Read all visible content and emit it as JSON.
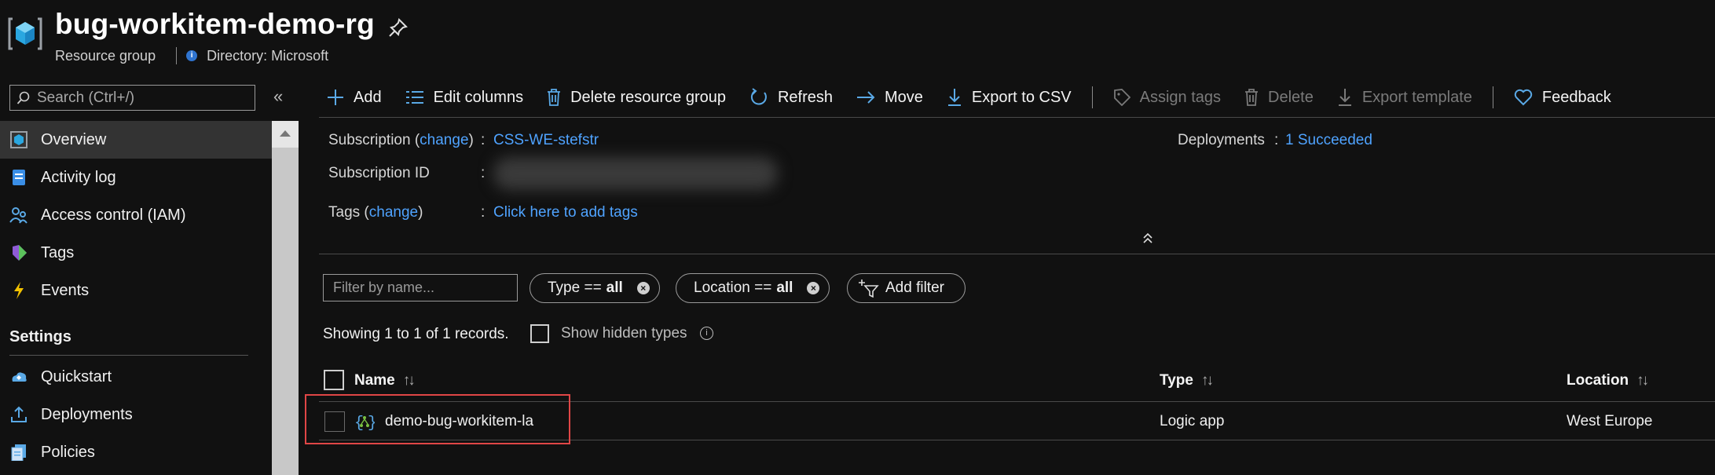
{
  "header": {
    "title": "bug-workitem-demo-rg",
    "resource_type": "Resource group",
    "directory": "Directory: Microsoft",
    "info_glyph": "i"
  },
  "sidebar": {
    "search_placeholder": "Search (Ctrl+/)",
    "collapse_glyph": "«",
    "items": [
      {
        "label": "Overview",
        "icon": "overview-icon",
        "active": true
      },
      {
        "label": "Activity log",
        "icon": "activity-log-icon"
      },
      {
        "label": "Access control (IAM)",
        "icon": "iam-icon"
      },
      {
        "label": "Tags",
        "icon": "tag-icon"
      },
      {
        "label": "Events",
        "icon": "lightning-icon"
      }
    ],
    "settings_header": "Settings",
    "settings_items": [
      {
        "label": "Quickstart",
        "icon": "quickstart-icon"
      },
      {
        "label": "Deployments",
        "icon": "deployments-icon"
      },
      {
        "label": "Policies",
        "icon": "policies-icon"
      }
    ]
  },
  "toolbar": {
    "add": "Add",
    "edit_columns": "Edit columns",
    "delete_rg": "Delete resource group",
    "refresh": "Refresh",
    "move": "Move",
    "export_csv": "Export to CSV",
    "assign_tags": "Assign tags",
    "delete": "Delete",
    "export_template": "Export template",
    "feedback": "Feedback"
  },
  "essentials": {
    "subscription_prefix": "Subscription (",
    "change": "change",
    "subscription_suffix": ")",
    "colon": ":",
    "subscription_value": "CSS-WE-stefstr",
    "subscription_id_label": "Subscription ID",
    "tags_prefix": "Tags (",
    "tags_suffix": ")",
    "tags_value": "Click here to add tags",
    "deployments_label": "Deployments",
    "deployments_value": "1 Succeeded"
  },
  "filters": {
    "name_placeholder": "Filter by name...",
    "type_label": "Type ==",
    "type_value": "all",
    "location_label": "Location ==",
    "location_value": "all",
    "add_filter": "Add filter",
    "clear_glyph": "×"
  },
  "records_text": "Showing 1 to 1 of 1 records.",
  "show_hidden_types": "Show hidden types",
  "table": {
    "columns": [
      "Name",
      "Type",
      "Location"
    ],
    "sort_glyph": "↑↓",
    "rows": [
      {
        "name": "demo-bug-workitem-la",
        "type": "Logic app",
        "location": "West Europe"
      }
    ]
  },
  "colors": {
    "link": "#4fa3ff",
    "accent": "#2f74d0",
    "highlight_border": "#e04646"
  }
}
